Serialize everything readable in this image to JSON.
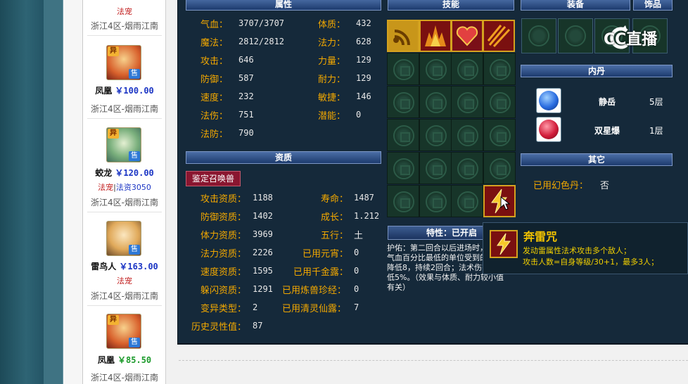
{
  "listing": {
    "top_partial": {
      "tag": "法宠",
      "server": "浙江4区-烟雨江南"
    },
    "items": [
      {
        "name": "凤凰",
        "price": "￥100.00",
        "server": "浙江4区-烟雨江南",
        "badge_top": "异",
        "badge_sell": "售"
      },
      {
        "name": "蛟龙",
        "price": "￥120.00",
        "tag_red": "法宠",
        "tag_blue": "法资3050",
        "server": "浙江4区-烟雨江南",
        "badge_top": "异",
        "badge_sell": "售"
      },
      {
        "name": "雷鸟人",
        "price": "￥163.00",
        "tag_red": "法宠",
        "server": "浙江4区-烟雨江南",
        "badge_sell": "售"
      },
      {
        "name": "凤凰",
        "price": "￥85.50",
        "server": "浙江4区-烟雨江南",
        "badge_top": "异",
        "badge_sell": "售"
      }
    ]
  },
  "attributes": {
    "header": "属性",
    "rows": [
      {
        "l1": "气血：",
        "v1": "3707/3707",
        "l2": "体质：",
        "v2": "432"
      },
      {
        "l1": "魔法：",
        "v1": "2812/2812",
        "l2": "法力：",
        "v2": "628"
      },
      {
        "l1": "攻击：",
        "v1": "646",
        "l2": "力量：",
        "v2": "129"
      },
      {
        "l1": "防御：",
        "v1": "587",
        "l2": "耐力：",
        "v2": "129"
      },
      {
        "l1": "速度：",
        "v1": "232",
        "l2": "敏捷：",
        "v2": "146"
      },
      {
        "l1": "法伤：",
        "v1": "751",
        "l2": "潜能：",
        "v2": "0"
      },
      {
        "l1": "法防：",
        "v1": "790"
      }
    ]
  },
  "aptitude": {
    "header": "资质",
    "identify_button": "鉴定召唤兽",
    "rows": [
      {
        "l1": "攻击资质：",
        "v1": "1188",
        "l2": "寿命：",
        "v2": "1487"
      },
      {
        "l1": "防御资质：",
        "v1": "1402",
        "l2": "成长：",
        "v2": "1.212"
      },
      {
        "l1": "体力资质：",
        "v1": "3969",
        "l2": "五行：",
        "v2": "土"
      },
      {
        "l1": "法力资质：",
        "v1": "2226",
        "l2": "已用元宵：",
        "v2": "0"
      },
      {
        "l1": "速度资质：",
        "v1": "1595",
        "l2": "已用千金露：",
        "v2": "0"
      },
      {
        "l1": "躲闪资质：",
        "v1": "1291",
        "l2": "已用炼兽珍经：",
        "v2": "0"
      },
      {
        "l1": "变异类型：",
        "v1": "2",
        "l2": "已用清灵仙露：",
        "v2": "7"
      },
      {
        "l1": "历史灵性值：",
        "v1": "87"
      }
    ]
  },
  "skills": {
    "header": "技能"
  },
  "trait": {
    "header": "特性：已开启",
    "text_1": "护佑：第二回合以后进场时，",
    "text_2": "气血百分比最低的单位受到的伤害",
    "text_3": "降低8，持续2回合；法术伤害力降",
    "text_4": "低5%。（效果与体质、耐力较小值",
    "text_5": "有关）"
  },
  "equipment": {
    "header": "装备",
    "accessory_header": "饰品"
  },
  "inner_pill": {
    "header": "内丹",
    "items": [
      {
        "name": "静岳",
        "level": "5层",
        "color": "#2a6ce0"
      },
      {
        "name": "双星爆",
        "level": "1层",
        "color": "#d21c3a"
      }
    ]
  },
  "other": {
    "header": "其它",
    "label": "已用幻色丹：",
    "value": "否"
  },
  "tooltip": {
    "title": "奔雷咒",
    "desc_1": "发动雷属性法术攻击多个敌人；",
    "desc_2": "攻击人数=自身等级/30+1，最多3人；"
  },
  "watermark": {
    "text": "CC直播"
  }
}
